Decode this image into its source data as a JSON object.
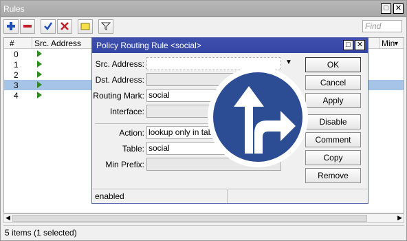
{
  "window": {
    "title": "Rules",
    "find_placeholder": "Find"
  },
  "table": {
    "columns": [
      "#",
      "Src. Address",
      "Min"
    ],
    "rows": [
      {
        "num": "0",
        "selected": false
      },
      {
        "num": "1",
        "selected": false
      },
      {
        "num": "2",
        "selected": false
      },
      {
        "num": "3",
        "selected": true
      },
      {
        "num": "4",
        "selected": false
      }
    ]
  },
  "status": "5 items (1 selected)",
  "dialog": {
    "title": "Policy Routing Rule <social>",
    "fields": {
      "src_address_label": "Src. Address:",
      "src_address": "",
      "dst_address_label": "Dst. Address:",
      "dst_address": "",
      "routing_mark_label": "Routing Mark:",
      "routing_mark": "social",
      "interface_label": "Interface:",
      "interface": "",
      "action_label": "Action:",
      "action": "lookup only in tab",
      "table_label": "Table:",
      "table": "social",
      "min_prefix_label": "Min Prefix:",
      "min_prefix": ""
    },
    "buttons": {
      "ok": "OK",
      "cancel": "Cancel",
      "apply": "Apply",
      "disable": "Disable",
      "comment": "Comment",
      "copy": "Copy",
      "remove": "Remove"
    },
    "status": "enabled"
  },
  "colors": {
    "dialog_title": "#3446a4",
    "selection": "#a6c4e8",
    "badge_sign": "#2c4c94"
  },
  "icons": [
    "add-icon",
    "remove-icon",
    "enable-check-icon",
    "disable-x-icon",
    "comment-note-icon",
    "filter-icon",
    "route-arrow-sign-icon"
  ]
}
